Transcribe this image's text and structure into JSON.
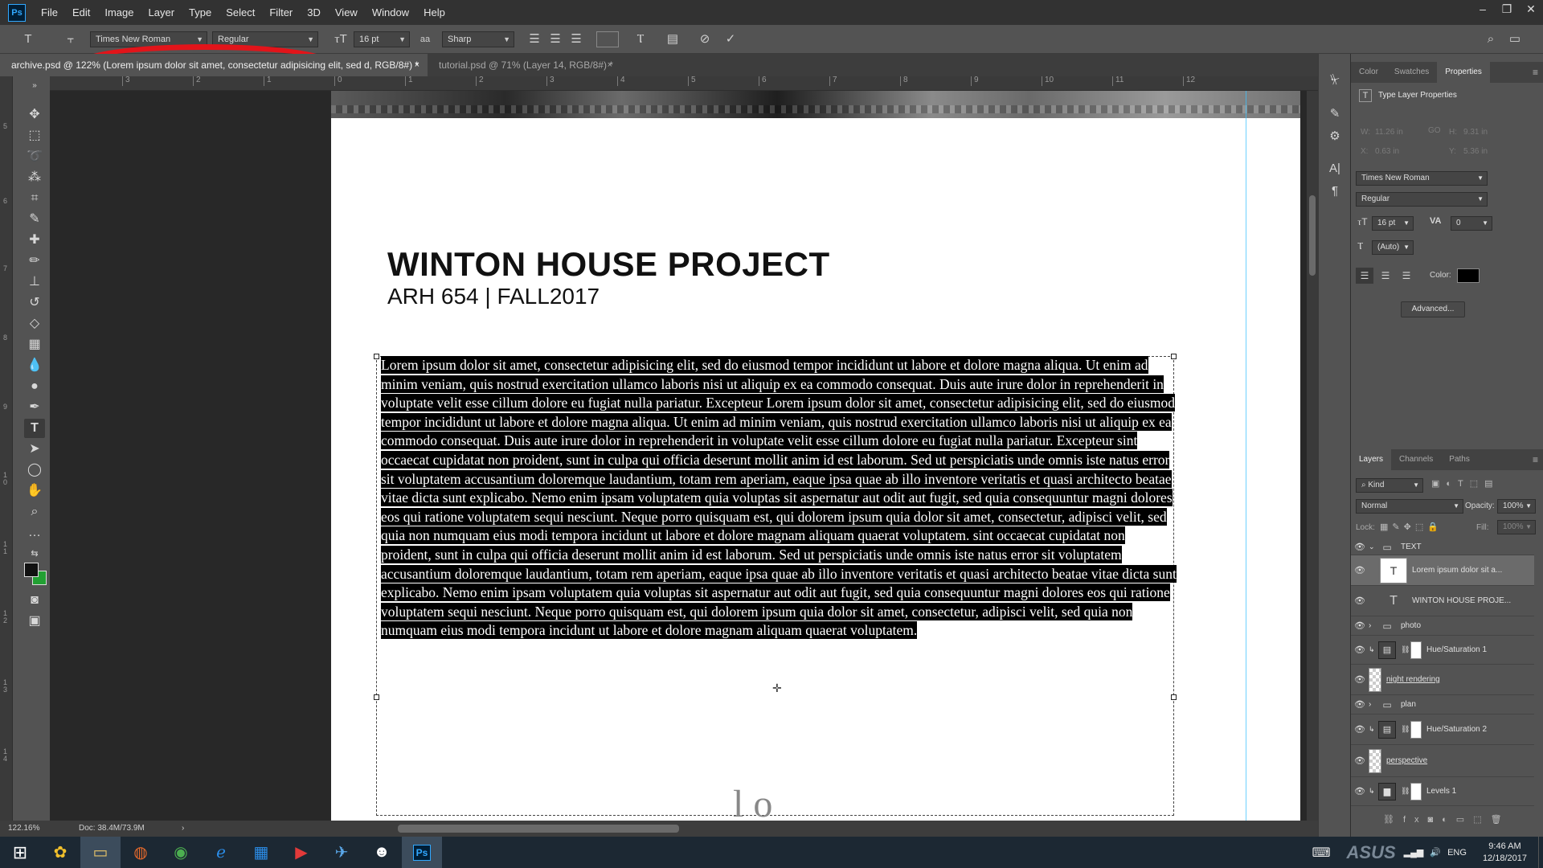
{
  "menubar": {
    "logo": "Ps",
    "items": [
      "File",
      "Edit",
      "Image",
      "Layer",
      "Type",
      "Select",
      "Filter",
      "3D",
      "View",
      "Window",
      "Help"
    ],
    "window_controls": [
      "–",
      "❐",
      "✕"
    ]
  },
  "options": {
    "tool_glyph": "T",
    "font_family": "Times New Roman",
    "font_style": "Regular",
    "font_size": "16 pt",
    "antialias_icon": "aa",
    "antialias": "Sharp",
    "text_color": "#000000",
    "highlight_color": "#e2141a"
  },
  "tabs": [
    {
      "label": "archive.psd @ 122% (Lorem ipsum dolor sit amet, consectetur adipisicing elit, sed d, RGB/8#) *",
      "close": "×"
    },
    {
      "label": "tutorial.psd @ 71% (Layer 14, RGB/8#) *",
      "close": "×"
    }
  ],
  "ruler_top": [
    "3",
    "2",
    "1",
    "0",
    "1",
    "2",
    "3",
    "4",
    "5",
    "6",
    "7",
    "8",
    "9",
    "10",
    "11",
    "12"
  ],
  "ruler_left": [
    "5",
    "6",
    "7",
    "8",
    "9",
    "1\n0",
    "1\n1",
    "1\n2",
    "1\n3",
    "1\n4"
  ],
  "document": {
    "title": "WINTON HOUSE PROJECT",
    "subtitle": "ARH 654  | FALL2017",
    "body": "Lorem ipsum dolor sit amet, consectetur adipisicing elit, sed do eiusmod tempor incididunt ut labore et dolore magna aliqua. Ut enim ad minim veniam, quis nostrud exercitation ullamco laboris nisi ut aliquip ex ea commodo consequat. Duis aute irure dolor in reprehenderit in voluptate velit esse cillum dolore eu fugiat nulla pariatur. Excepteur Lorem ipsum dolor sit amet, consectetur adipisicing elit, sed do eiusmod tempor incididunt ut labore et dolore magna aliqua. Ut enim ad minim veniam, quis nostrud exercitation ullamco laboris nisi ut aliquip ex ea commodo consequat. Duis aute irure dolor in reprehenderit in voluptate velit esse cillum dolore eu fugiat nulla pariatur. Excepteur sint occaecat cupidatat non proident, sunt in culpa qui officia deserunt mollit anim id est laborum. Sed ut perspiciatis unde omnis iste natus error sit voluptatem accusantium doloremque laudantium, totam rem aperiam, eaque ipsa quae ab illo inventore veritatis et quasi architecto beatae vitae dicta sunt explicabo. Nemo enim ipsam voluptatem quia voluptas sit aspernatur aut odit aut fugit, sed quia consequuntur magni dolores eos qui ratione voluptatem sequi nesciunt. Neque porro quisquam est, qui dolorem ipsum quia dolor sit amet, consectetur, adipisci velit, sed quia non numquam eius modi tempora incidunt ut labore et dolore magnam aliquam quaerat voluptatem. sint occaecat cupidatat non proident, sunt in culpa qui officia deserunt mollit anim id est laborum. Sed ut perspiciatis unde omnis iste natus error sit voluptatem accusantium doloremque laudantium, totam rem aperiam, eaque ipsa quae ab illo inventore veritatis et quasi architecto beatae vitae dicta sunt explicabo. Nemo enim ipsam voluptatem quia voluptas sit aspernatur aut odit aut fugit, sed quia consequuntur magni dolores eos qui ratione voluptatem sequi nesciunt. Neque porro quisquam est, qui dolorem ipsum quia dolor sit amet, consectetur, adipisci velit, sed quia non numquam eius modi tempora incidunt ut labore et dolore magnam aliquam quaerat voluptatem.",
    "bottom_glyph": "l o"
  },
  "status": {
    "zoom": "122.16%",
    "doc": "Doc: 38.4M/73.9M",
    "arrow": "›"
  },
  "properties_panel": {
    "tabs": [
      "Color",
      "Swatches",
      "Properties"
    ],
    "header": "Type Layer Properties",
    "w_label": "W:",
    "w_value": "11.26 in",
    "h_label": "H:",
    "h_value": "9.31 in",
    "x_label": "X:",
    "x_value": "0.63 in",
    "y_label": "Y:",
    "y_value": "5.36 in",
    "link_icon": "GO",
    "font_family": "Times New Roman",
    "font_style": "Regular",
    "font_size": "16 pt",
    "tracking": "0",
    "leading": "(Auto)",
    "color_label": "Color:",
    "color": "#000000",
    "advanced": "Advanced..."
  },
  "layers_panel": {
    "tabs": [
      "Layers",
      "Channels",
      "Paths"
    ],
    "kind": "Kind",
    "blend_mode": "Normal",
    "opacity_label": "Opacity:",
    "opacity": "100%",
    "lock_label": "Lock:",
    "fill_label": "Fill:",
    "fill": "100%",
    "layers": [
      {
        "name": "TEXT",
        "type": "folder",
        "indent": 0,
        "twirl": "⌄"
      },
      {
        "name": "Lorem ipsum dolor sit a...",
        "type": "text",
        "indent": 1,
        "selected": true
      },
      {
        "name": "WINTON HOUSE PROJE...",
        "type": "text",
        "indent": 1
      },
      {
        "name": "photo",
        "type": "folder",
        "indent": 0,
        "twirl": "›"
      },
      {
        "name": "Hue/Saturation 1",
        "type": "adjustment",
        "indent": 0
      },
      {
        "name": "night rendering",
        "type": "image",
        "indent": 0
      },
      {
        "name": "plan",
        "type": "folder",
        "indent": 0,
        "twirl": "›"
      },
      {
        "name": "Hue/Saturation 2",
        "type": "adjustment",
        "indent": 0
      },
      {
        "name": "perspective",
        "type": "image",
        "indent": 0
      },
      {
        "name": "Levels 1",
        "type": "adjustment",
        "indent": 0
      }
    ]
  },
  "taskbar": {
    "lang": "ENG",
    "brand": "ASUS",
    "time": "9:46 AM",
    "date": "12/18/2017"
  }
}
